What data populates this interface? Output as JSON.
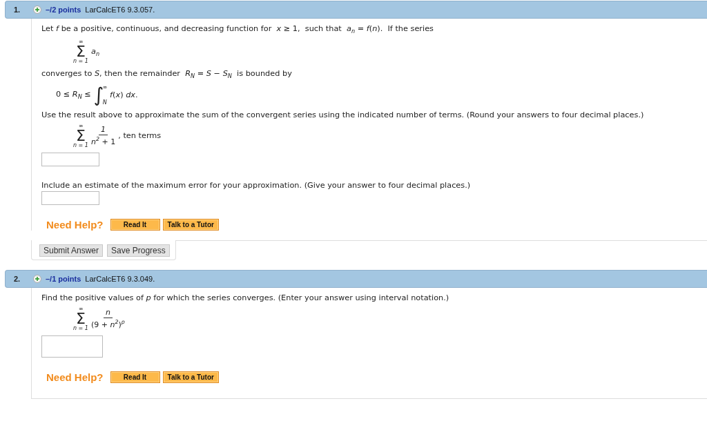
{
  "questions": [
    {
      "number": "1.",
      "expanded": false,
      "points": "–/2 points",
      "source": "LarCalcET6 9.3.057.",
      "blocks": [
        {
          "kind": "text",
          "text": "Let *f* be a positive, continuous, and decreasing function for  *x* ≥ 1,  such that  *a*$_{n}$ = *f*(*n*).  If the series"
        },
        {
          "kind": "sum",
          "upper": "∞",
          "sigma": "Σ",
          "lower": "*n* = 1",
          "term": "*a*$_{n}$"
        },
        {
          "kind": "text",
          "text": "converges to *S*, then the remainder  *R*$_{N}$ = *S* − *S*$_{N}$  is bounded by"
        },
        {
          "kind": "integral",
          "left": "0 ≤ *R*$_{N}$ ≤",
          "sign": "∫",
          "upper": "∞",
          "lower": "N",
          "term": "*f*(*x*) *dx*."
        },
        {
          "kind": "text",
          "text": "Use the result above to approximate the sum of the convergent series using the indicated number of terms. (Round your answers to four decimal places.)"
        },
        {
          "kind": "fraction-sum",
          "upper": "∞",
          "sigma": "Σ",
          "lower": "*n* = 1",
          "numerator": "1",
          "denominator": "*n*$^{2}$ + 1",
          "after": ", ten terms"
        },
        {
          "kind": "answer"
        },
        {
          "kind": "text",
          "text": "Include an estimate of the maximum error for your approximation. (Give your answer to four decimal places.)"
        },
        {
          "kind": "answer"
        }
      ],
      "help": {
        "label": "Need Help?",
        "buttons": [
          "Read It",
          "Talk to a Tutor"
        ]
      },
      "actions": [
        "Submit Answer",
        "Save Progress"
      ]
    },
    {
      "number": "2.",
      "expanded": false,
      "points": "–/1 points",
      "source": "LarCalcET6 9.3.049.",
      "blocks": [
        {
          "kind": "text",
          "text": "Find the positive values of *p* for which the series converges. (Enter your answer using interval notation.)"
        },
        {
          "kind": "fraction-sum",
          "upper": "∞",
          "sigma": "Σ",
          "lower": "*n* = 1",
          "numerator": "*n*",
          "denominator": "(9 + *n*$^{2}$)$^{p}$"
        },
        {
          "kind": "tall-answer"
        }
      ],
      "help": {
        "label": "Need Help?",
        "buttons": [
          "Read It",
          "Talk to a Tutor"
        ]
      }
    }
  ]
}
